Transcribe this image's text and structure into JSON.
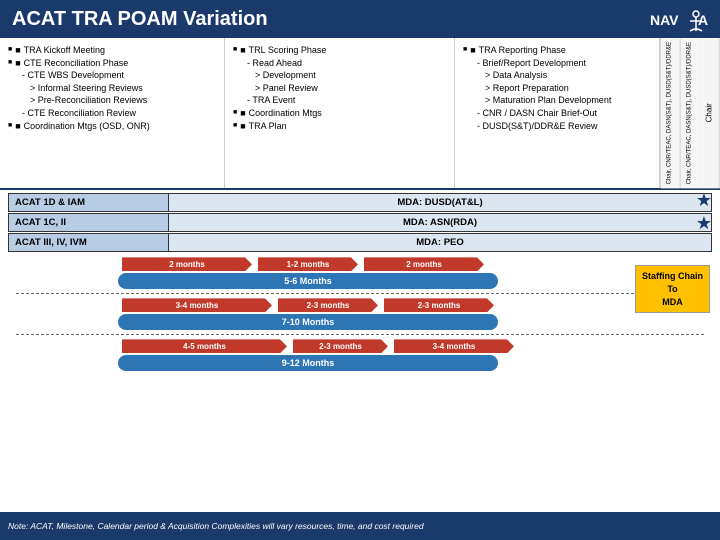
{
  "header": {
    "title": "ACAT TRA POAM Variation",
    "logo": "NAVAIR"
  },
  "bullets_left": {
    "items": [
      {
        "text": "TRA Kickoff Meeting",
        "level": 1
      },
      {
        "text": "CTE Reconciliation Phase",
        "level": 1
      },
      {
        "text": "- CTE WBS Development",
        "level": 2
      },
      {
        "text": "> Informal Steering Reviews",
        "level": 3
      },
      {
        "text": "> Pre-Reconciliation Reviews",
        "level": 3
      },
      {
        "text": "- CTE Reconciliation Review",
        "level": 2
      },
      {
        "text": "Coordination Mtgs (OSD, ONR)",
        "level": 1
      }
    ]
  },
  "bullets_mid": {
    "items": [
      {
        "text": "TRL Scoring Phase",
        "level": 1
      },
      {
        "text": "- Read Ahead",
        "level": 2
      },
      {
        "text": "> Development",
        "level": 3
      },
      {
        "text": "> Panel Review",
        "level": 3
      },
      {
        "text": "- TRA Event",
        "level": 2
      },
      {
        "text": "Coordination Mtgs",
        "level": 1
      },
      {
        "text": "TRA Plan",
        "level": 1
      }
    ]
  },
  "bullets_right": {
    "items": [
      {
        "text": "TRA Reporting Phase",
        "level": 1
      },
      {
        "text": "- Brief/Report Development",
        "level": 2
      },
      {
        "text": "> Data Analysis",
        "level": 3
      },
      {
        "text": "> Report Preparation",
        "level": 3
      },
      {
        "text": "> Maturation Plan Development",
        "level": 3
      },
      {
        "text": "- CNR / DASN Chair Brief-Out",
        "level": 2
      },
      {
        "text": "- DUSD(S&T)/DDR&E Review",
        "level": 2
      }
    ]
  },
  "vertical_labels": [
    "Chair, CNR/TEAC, DASN(S&T), DUSD(S&T)/DDR&E",
    "Chair, CNR/TEAC, DASN(S&T), DUSD(S&T)/DDR&E",
    "Chair"
  ],
  "mda_rows": [
    {
      "left": "ACAT 1D & IAM",
      "right": "MDA: DUSD(AT&L)"
    },
    {
      "left": "ACAT 1C, II",
      "right": "MDA: ASN(RDA)"
    },
    {
      "left": "ACAT III, IV, IVM",
      "right": "MDA: PEO"
    }
  ],
  "timeline_groups": [
    {
      "total_label": "5-6 Months",
      "total_color": "#2e75b6",
      "rows": [
        {
          "bar1_label": "2 months",
          "bar2_label": "1-2 months",
          "bar3_label": "2 months"
        }
      ]
    },
    {
      "total_label": "7-10 Months",
      "total_color": "#2e75b6",
      "rows": [
        {
          "bar1_label": "3-4 months",
          "bar2_label": "2-3 months",
          "bar3_label": "2-3 months"
        }
      ]
    },
    {
      "total_label": "9-12 Months",
      "total_color": "#2e75b6",
      "rows": [
        {
          "bar1_label": "4-5 months",
          "bar2_label": "2-3 months",
          "bar3_label": "3-4 months"
        }
      ]
    }
  ],
  "staffing_box": {
    "line1": "Staffing Chain",
    "line2": "To",
    "line3": "MDA"
  },
  "bottom_note": "Note: ACAT, Milestone, Calendar period & Acquisition Complexities will vary resources, time, and cost required",
  "stars": [
    "★",
    "★"
  ]
}
